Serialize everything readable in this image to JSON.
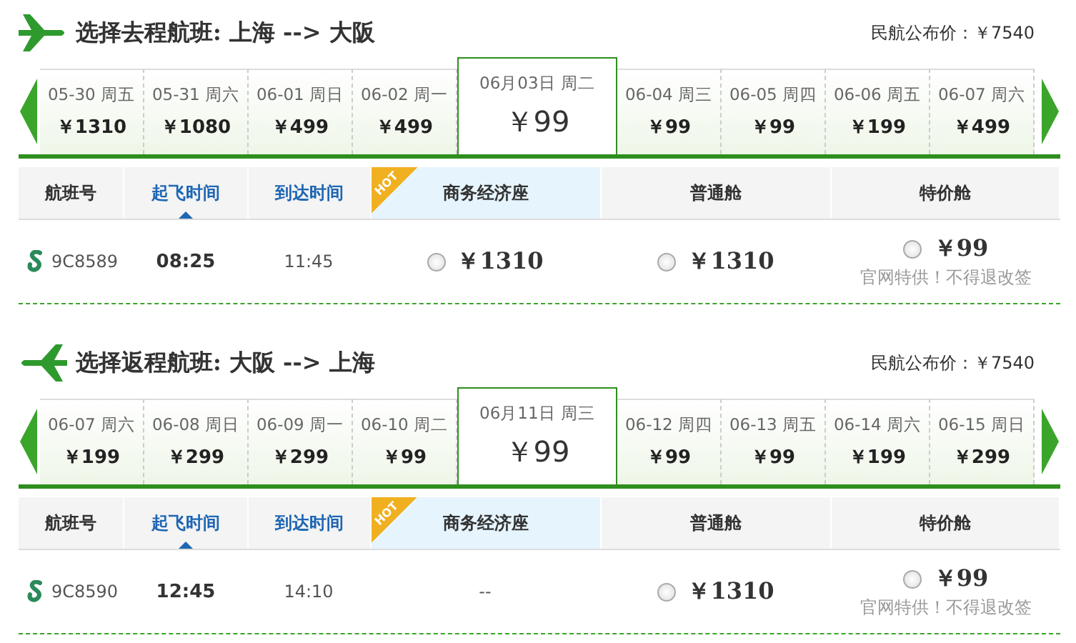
{
  "sections": [
    {
      "title": "选择去程航班: 上海 --> 大阪",
      "published_price": "民航公布价：￥7540",
      "dates": [
        {
          "date": "05-30 周五",
          "price": "￥1310",
          "selected": false
        },
        {
          "date": "05-31 周六",
          "price": "￥1080",
          "selected": false
        },
        {
          "date": "06-01 周日",
          "price": "￥499",
          "selected": false
        },
        {
          "date": "06-02 周一",
          "price": "￥499",
          "selected": false
        },
        {
          "date": "06月03日 周二",
          "price": "￥99",
          "selected": true
        },
        {
          "date": "06-04 周三",
          "price": "￥99",
          "selected": false
        },
        {
          "date": "06-05 周四",
          "price": "￥99",
          "selected": false
        },
        {
          "date": "06-06 周五",
          "price": "￥199",
          "selected": false
        },
        {
          "date": "06-07 周六",
          "price": "￥499",
          "selected": false
        }
      ],
      "columns": [
        {
          "label": "航班号",
          "kind": "plain",
          "sorted": false
        },
        {
          "label": "起飞时间",
          "kind": "sortable",
          "sorted": true
        },
        {
          "label": "到达时间",
          "kind": "sortable",
          "sorted": false
        },
        {
          "label": "商务经济座",
          "kind": "hot",
          "badge": "HOT",
          "sorted": false
        },
        {
          "label": "普通舱",
          "kind": "plain",
          "sorted": false
        },
        {
          "label": "特价舱",
          "kind": "plain",
          "sorted": false
        }
      ],
      "flight": {
        "number": "9C8589",
        "depart": "08:25",
        "arrive": "11:45",
        "fares": [
          {
            "price": "￥1310",
            "selected": false
          },
          {
            "price": "￥1310",
            "selected": false
          },
          {
            "price": "￥99",
            "selected": false,
            "note": "官网特供！不得退改签"
          }
        ]
      }
    },
    {
      "title": "选择返程航班: 大阪 --> 上海",
      "published_price": "民航公布价：￥7540",
      "dates": [
        {
          "date": "06-07 周六",
          "price": "￥199",
          "selected": false
        },
        {
          "date": "06-08 周日",
          "price": "￥299",
          "selected": false
        },
        {
          "date": "06-09 周一",
          "price": "￥299",
          "selected": false
        },
        {
          "date": "06-10 周二",
          "price": "￥99",
          "selected": false
        },
        {
          "date": "06月11日 周三",
          "price": "￥99",
          "selected": true
        },
        {
          "date": "06-12 周四",
          "price": "￥99",
          "selected": false
        },
        {
          "date": "06-13 周五",
          "price": "￥99",
          "selected": false
        },
        {
          "date": "06-14 周六",
          "price": "￥199",
          "selected": false
        },
        {
          "date": "06-15 周日",
          "price": "￥299",
          "selected": false
        }
      ],
      "columns": [
        {
          "label": "航班号",
          "kind": "plain",
          "sorted": false
        },
        {
          "label": "起飞时间",
          "kind": "sortable",
          "sorted": true
        },
        {
          "label": "到达时间",
          "kind": "sortable",
          "sorted": false
        },
        {
          "label": "商务经济座",
          "kind": "hot",
          "badge": "HOT",
          "sorted": false
        },
        {
          "label": "普通舱",
          "kind": "plain",
          "sorted": false
        },
        {
          "label": "特价舱",
          "kind": "plain",
          "sorted": false
        }
      ],
      "flight": {
        "number": "9C8590",
        "depart": "12:45",
        "arrive": "14:10",
        "fares": [
          {
            "price": "--",
            "kind": "none"
          },
          {
            "price": "￥1310",
            "selected": false
          },
          {
            "price": "￥99",
            "selected": false,
            "note": "官网特供！不得退改签"
          }
        ]
      }
    }
  ]
}
